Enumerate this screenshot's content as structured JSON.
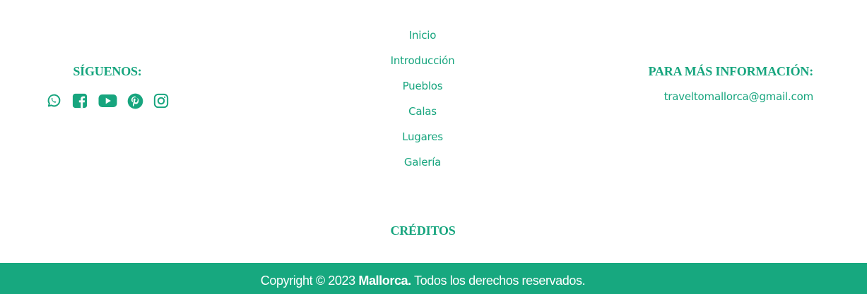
{
  "follow": {
    "heading": "SÍGUENOS:",
    "icons": [
      "whatsapp-icon",
      "facebook-icon",
      "youtube-icon",
      "pinterest-icon",
      "instagram-icon"
    ]
  },
  "nav": {
    "items": [
      "Inicio",
      "Introducción",
      "Pueblos",
      "Calas",
      "Lugares",
      "Galería"
    ]
  },
  "info": {
    "heading": "PARA MÁS INFORMACIÓN:",
    "email": "traveltomallorca@gmail.com"
  },
  "credits": {
    "label": "CRÉDITOS"
  },
  "copyright": {
    "prefix": "Copyright © 2023 ",
    "brand": "Mallorca.",
    "suffix": " Todos los derechos reservados."
  },
  "colors": {
    "accent": "#17a57e",
    "bar": "#17a87f",
    "bar_text": "#ffffff"
  }
}
